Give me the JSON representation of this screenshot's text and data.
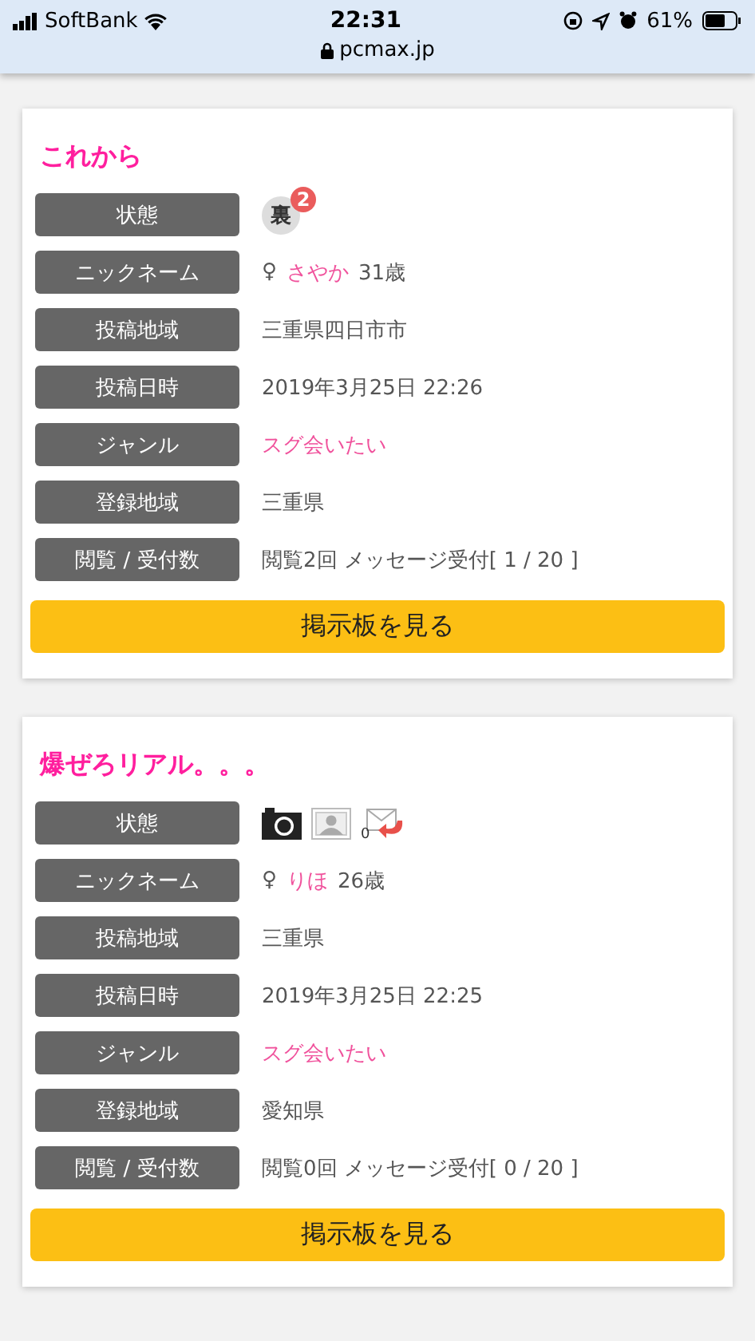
{
  "status_bar": {
    "carrier": "SoftBank",
    "time": "22:31",
    "battery": "61%",
    "url": "pcmax.jp"
  },
  "posts": [
    {
      "title": "これから",
      "rows": [
        {
          "kind": "status",
          "label": "状態",
          "icons": [
            {
              "kind": "ura",
              "text": "裏",
              "count": "2"
            }
          ]
        },
        {
          "kind": "nickname",
          "label": "ニックネーム",
          "symbol": "♀",
          "name": "さやか",
          "age": "31歳"
        },
        {
          "kind": "text",
          "label": "投稿地域",
          "value": "三重県四日市市"
        },
        {
          "kind": "text",
          "label": "投稿日時",
          "value": "2019年3月25日 22:26"
        },
        {
          "kind": "link",
          "label": "ジャンル",
          "value": "スグ会いたい"
        },
        {
          "kind": "text",
          "label": "登録地域",
          "value": "三重県"
        },
        {
          "kind": "text",
          "label": "閲覧 / 受付数",
          "value": "閲覧2回 メッセージ受付[ 1 / 20 ]"
        }
      ],
      "button": "掲示板を見る"
    },
    {
      "title": "爆ぜろリアル。。。",
      "rows": [
        {
          "kind": "status",
          "label": "状態",
          "icons": [
            {
              "kind": "camera"
            },
            {
              "kind": "photo"
            },
            {
              "kind": "mail",
              "count": "0"
            }
          ]
        },
        {
          "kind": "nickname",
          "label": "ニックネーム",
          "symbol": "♀",
          "name": "りほ",
          "age": "26歳"
        },
        {
          "kind": "text",
          "label": "投稿地域",
          "value": "三重県"
        },
        {
          "kind": "text",
          "label": "投稿日時",
          "value": "2019年3月25日 22:25"
        },
        {
          "kind": "link",
          "label": "ジャンル",
          "value": "スグ会いたい"
        },
        {
          "kind": "text",
          "label": "登録地域",
          "value": "愛知県"
        },
        {
          "kind": "text",
          "label": "閲覧 / 受付数",
          "value": "閲覧0回 メッセージ受付[ 0 / 20 ]"
        }
      ],
      "button": "掲示板を見る"
    }
  ]
}
